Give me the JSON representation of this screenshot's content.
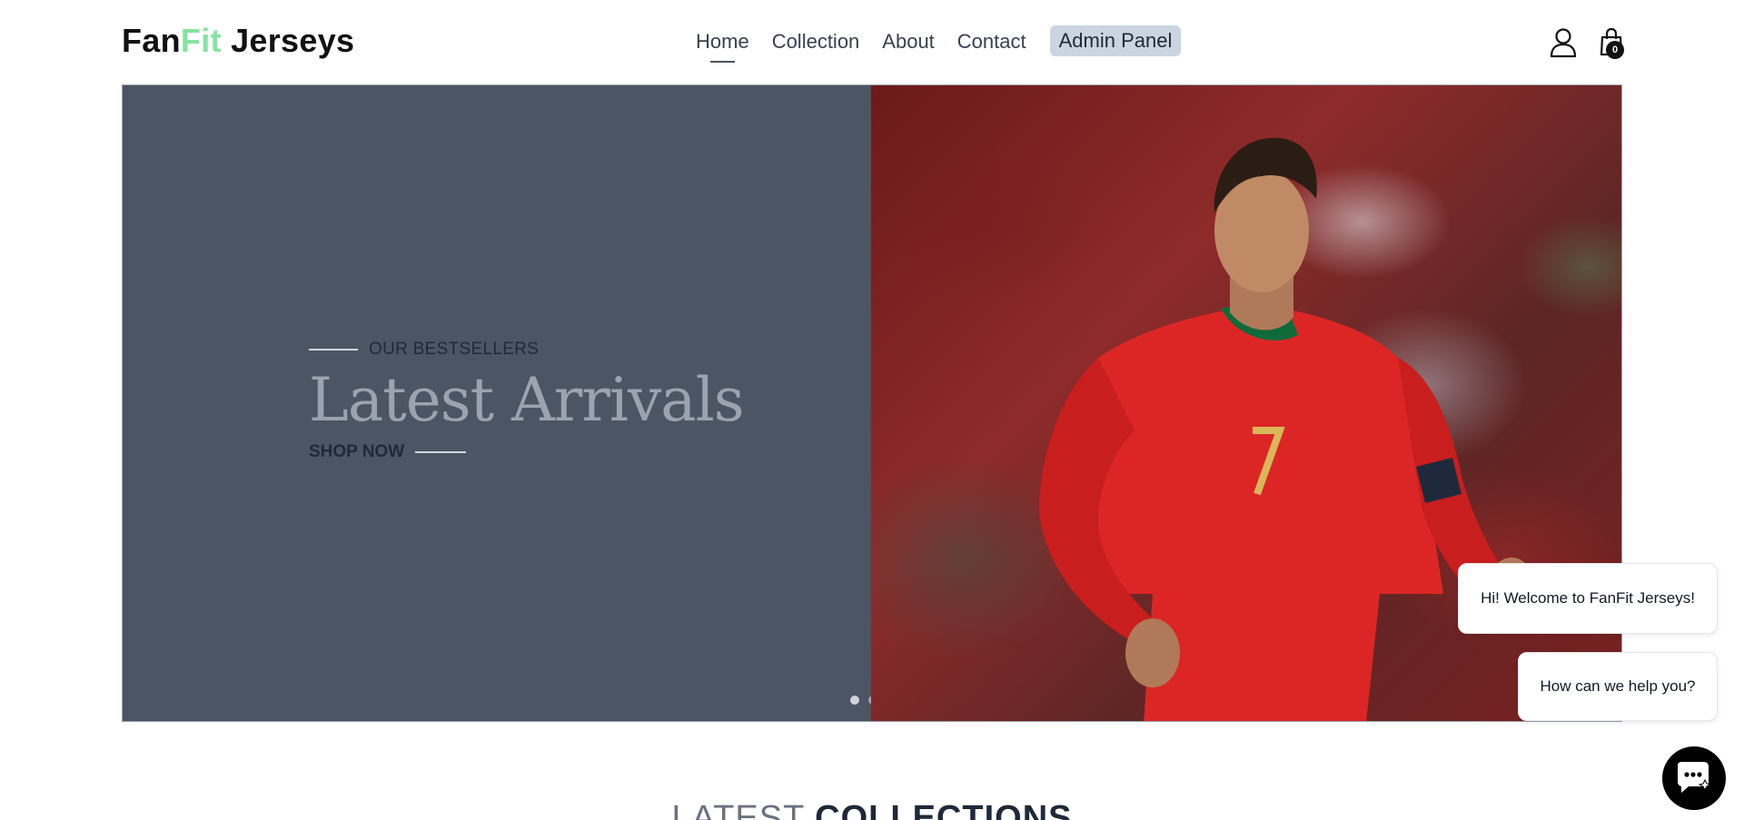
{
  "brand": {
    "part1": "Fan",
    "part2": "Fit",
    "part3": " Jerseys"
  },
  "nav": {
    "items": [
      {
        "label": "Home",
        "active": true
      },
      {
        "label": "Collection",
        "active": false
      },
      {
        "label": "About",
        "active": false
      },
      {
        "label": "Contact",
        "active": false
      }
    ],
    "admin_label": "Admin Panel"
  },
  "header_icons": {
    "user": "user-icon",
    "cart": "shopping-bag-icon",
    "cart_count": "0"
  },
  "hero": {
    "eyebrow": "OUR BESTSELLERS",
    "title": "Latest Arrivals",
    "cta": "SHOP NOW",
    "slides": 2,
    "active_slide": 2
  },
  "chat": {
    "messages": [
      "Hi! Welcome to FanFit Jerseys!",
      "How can we help you?"
    ],
    "button_icon": "chat-icon"
  },
  "latest_collections": {
    "light": "LATEST ",
    "bold": "COLLECTIONS"
  },
  "colors": {
    "brand_accent": "#86e3a1",
    "hero_panel": "#4b5563",
    "admin_button_bg": "#cbd5e1",
    "jersey_red": "#dc2626"
  }
}
